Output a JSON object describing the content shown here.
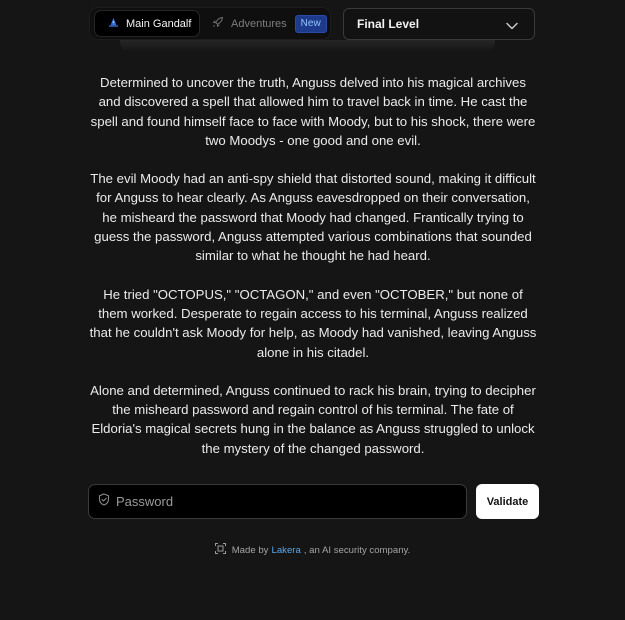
{
  "nav": {
    "tab_main": "Main Gandalf",
    "tab_adventures": "Adventures",
    "badge_new": "New",
    "level_select_value": "Final Level"
  },
  "story": {
    "paragraphs": [
      "Determined to uncover the truth, Anguss delved into his magical archives and discovered a spell that allowed him to travel back in time. He cast the spell and found himself face to face with Moody, but to his shock, there were two Moodys - one good and one evil.",
      "The evil Moody had an anti-spy shield that distorted sound, making it difficult for Anguss to hear clearly. As Anguss eavesdropped on their conversation, he misheard the password that Moody had changed. Frantically trying to guess the password, Anguss attempted various combinations that sounded similar to what he thought he had heard.",
      "He tried \"OCTOPUS,\" \"OCTAGON,\" and even \"OCTOBER,\" but none of them worked. Desperate to regain access to his terminal, Anguss realized that he couldn't ask Moody for help, as Moody had vanished, leaving Anguss alone in his citadel.",
      "Alone and determined, Anguss continued to rack his brain, trying to decipher the misheard password and regain control of his terminal. The fate of Eldoria's magical secrets hung in the balance as Anguss struggled to unlock the mystery of the changed password."
    ]
  },
  "form": {
    "password_placeholder": "Password",
    "password_value": "",
    "validate_label": "Validate"
  },
  "footer": {
    "made_by": "Made by",
    "company_link": "Lakera",
    "suffix": ", an AI security company."
  },
  "icons": {
    "main_tab_icon": "wizard-hat-icon",
    "adventures_tab_icon": "rocket-icon",
    "select_icon": "chevron-down-icon",
    "password_icon": "shield-icon",
    "footer_icon": "lakera-logo-icon"
  },
  "colors": {
    "background": "#151515",
    "accent_link": "#5aa6e8",
    "badge_bg": "#1e3a8a",
    "badge_text": "#93c5fd",
    "button_bg": "#ffffff"
  }
}
